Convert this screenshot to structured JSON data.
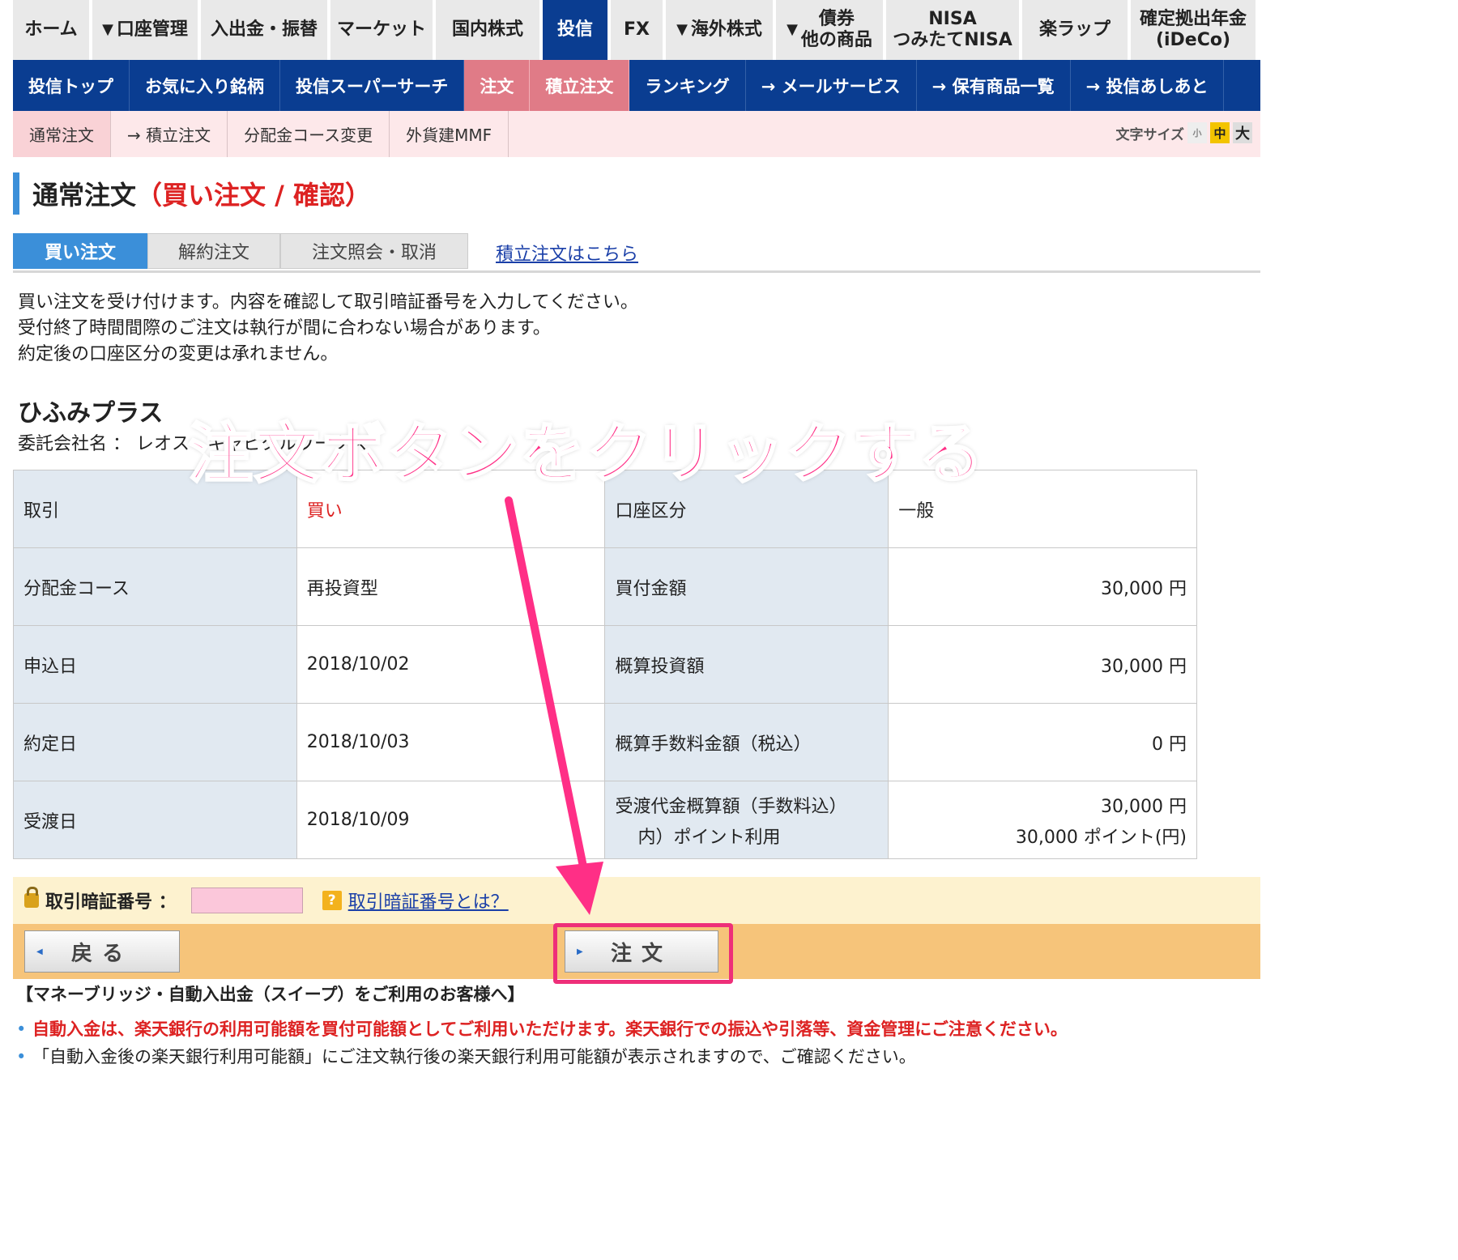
{
  "topnav": {
    "items": [
      {
        "label": "ホーム"
      },
      {
        "label": "口座管理",
        "dropdown": true
      },
      {
        "label": "入出金・振替"
      },
      {
        "label": "マーケット"
      },
      {
        "label": "国内株式"
      },
      {
        "label": "投信",
        "active": true
      },
      {
        "label": "FX"
      },
      {
        "label": "海外株式",
        "dropdown": true
      },
      {
        "line1": "債券",
        "line2": "他の商品",
        "dropdown": true
      },
      {
        "line1": "NISA",
        "line2": "つみたてNISA"
      },
      {
        "label": "楽ラップ"
      },
      {
        "line1": "確定拠出年金",
        "line2": "(iDeCo)"
      }
    ]
  },
  "subnav": {
    "items": [
      "投信トップ",
      "お気に入り銘柄",
      "投信スーパーサーチ",
      "注文",
      "積立注文",
      "ランキング",
      "→ メールサービス",
      "→ 保有商品一覧",
      "→ 投信あしあと"
    ]
  },
  "thirdnav": {
    "items": [
      "通常注文",
      "→ 積立注文",
      "分配金コース変更",
      "外貨建MMF"
    ],
    "font_size_label": "文字サイズ",
    "font_sizes": [
      "小",
      "中",
      "大"
    ]
  },
  "page": {
    "title_main": "通常注文",
    "title_sub": "（買い注文 / 確認）"
  },
  "tabs": {
    "buy": "買い注文",
    "cancel": "解約注文",
    "inquiry": "注文照会・取消",
    "link": "積立注文はこちら"
  },
  "description": [
    "買い注文を受け付けます。内容を確認して取引暗証番号を入力してください。",
    "受付終了時間間際のご注文は執行が間に合わない場合があります。",
    "約定後の口座区分の変更は承れません。"
  ],
  "fund": {
    "name": "ひふみプラス",
    "company_label": "委託会社名 ： レオス・キャピタルワークス"
  },
  "order": {
    "rows": [
      {
        "l1": "取引",
        "v1": "買い",
        "l2": "口座区分",
        "v2": "一般"
      },
      {
        "l1": "分配金コース",
        "v1": "再投資型",
        "l2": "買付金額",
        "v2": "30,000 円"
      },
      {
        "l1": "申込日",
        "v1": "2018/10/02",
        "l2": "概算投資額",
        "v2": "30,000 円"
      },
      {
        "l1": "約定日",
        "v1": "2018/10/03",
        "l2": "概算手数料金額（税込）",
        "v2": "0 円"
      },
      {
        "l1": "受渡日",
        "v1": "2018/10/09",
        "l2": "受渡代金概算額（手数料込）",
        "l2b": "内）ポイント利用",
        "v2": "30,000 円",
        "v2b": "30,000 ポイント(円)"
      }
    ]
  },
  "pin": {
    "label": "取引暗証番号 ：",
    "value": "",
    "help_icon": "?",
    "help_link": "取引暗証番号とは？"
  },
  "buttons": {
    "back": "戻る",
    "order": "注文"
  },
  "notes": {
    "heading": "【マネーブリッジ・自動入出金（スイープ）をご利用のお客様へ】",
    "warning": "自動入金は、楽天銀行の利用可能額を買付可能額としてご利用いただけます。楽天銀行での振込や引落等、資金管理にご注意ください。",
    "info": "「自動入金後の楽天銀行利用可能額」にご注文執行後の楽天銀行利用可能額が表示されますので、ご確認ください。"
  },
  "annotation": {
    "text": "注文ボタンをクリックする",
    "color": "#ff2f86"
  },
  "colors": {
    "nav_blue": "#0a3d91",
    "accent_red": "#dd2222",
    "highlight_pink": "#ee2f79",
    "pin_bg": "#fdf2cf",
    "button_bar": "#f6c47a"
  }
}
